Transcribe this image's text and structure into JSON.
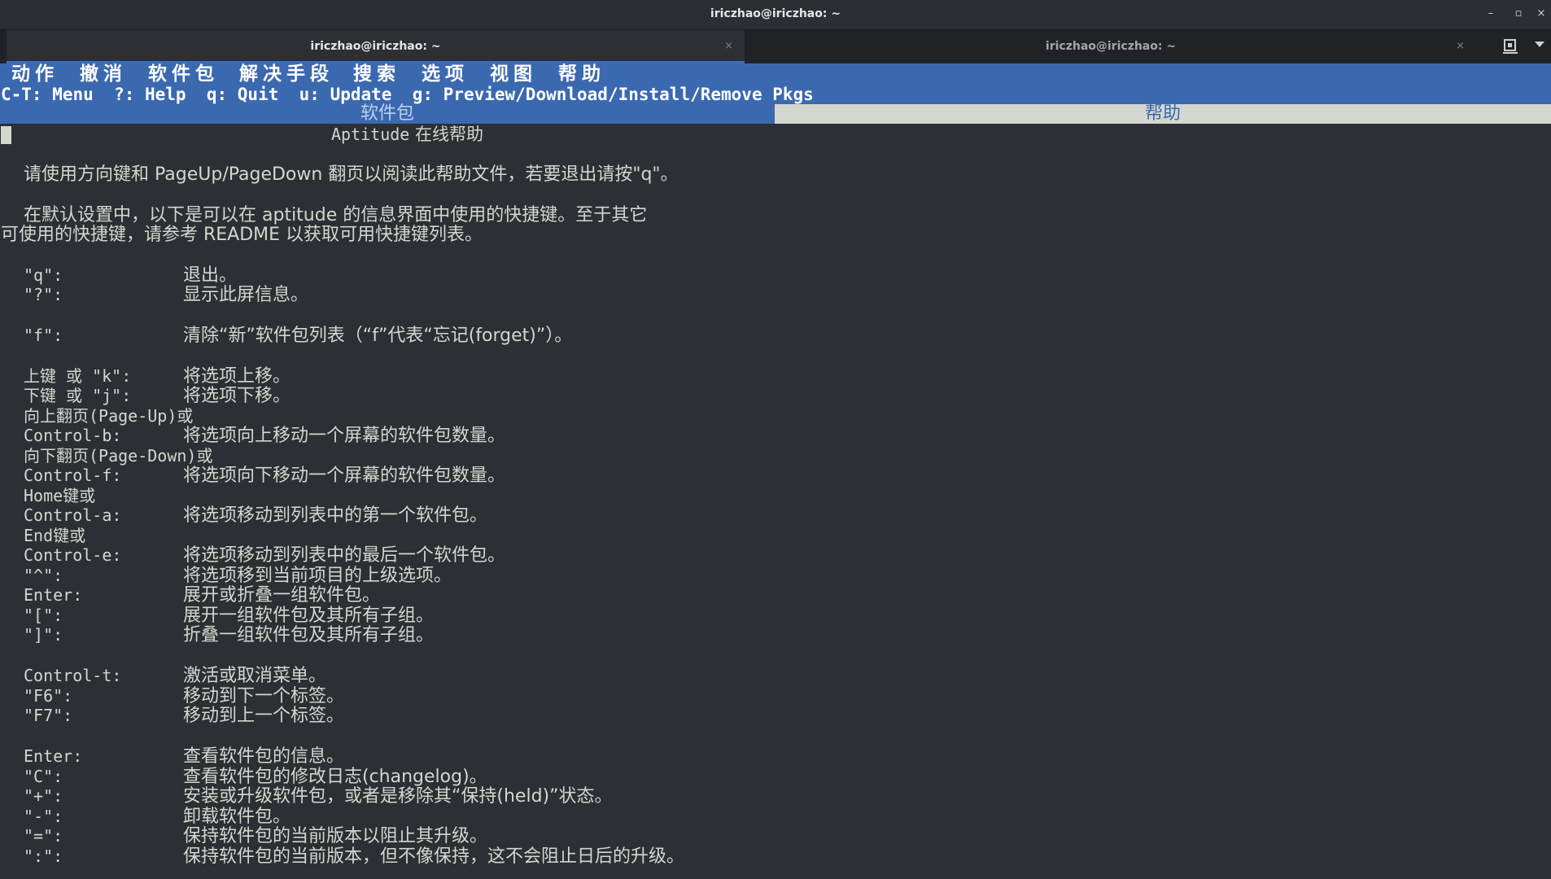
{
  "window": {
    "title": "iriczhao@iriczhao: ~",
    "controls": {
      "minimize": "–",
      "maximize": "▫",
      "close": "×"
    }
  },
  "tabs": [
    {
      "label": "iriczhao@iriczhao: ~",
      "active": true,
      "close": "×"
    },
    {
      "label": "iriczhao@iriczhao: ~",
      "active": false,
      "close": "×"
    }
  ],
  "menu": [
    "动作",
    "撤消",
    "软件包",
    "解决手段",
    "搜索",
    "选项",
    "视图",
    "帮助"
  ],
  "hint": "C-T: Menu  ?: Help  q: Quit  u: Update  g: Preview/Download/Install/Remove Pkgs",
  "view_tabs": {
    "packages": "软件包",
    "help": "帮助"
  },
  "doc": {
    "title_latin": "Aptitude",
    "title_cjk": " 在线帮助",
    "intro": "请使用方向键和 PageUp/PageDown 翻页以阅读此帮助文件，若要退出请按\"q\"。",
    "para1_line1": "在默认设置中，以下是可以在 aptitude 的信息界面中使用的快捷键。至于其它",
    "para1_line2": "可使用的快捷键，请参考 README 以获取可用快捷键列表。",
    "keys": [
      {
        "key": "\"q\":",
        "desc": "退出。"
      },
      {
        "key": "\"?\":",
        "desc": "显示此屏信息。"
      },
      {
        "key": "\"f\":",
        "desc": "清除“新”软件包列表（“f”代表“忘记(forget)”）。"
      },
      {
        "key": "上键 或 \"k\":",
        "desc": "将选项上移。"
      },
      {
        "key": "下键 或 \"j\":",
        "desc": "将选项下移。"
      },
      {
        "key": "向上翻页(Page-Up)或",
        "desc": ""
      },
      {
        "key": "Control-b:",
        "desc": "将选项向上移动一个屏幕的软件包数量。"
      },
      {
        "key": "向下翻页(Page-Down)或",
        "desc": ""
      },
      {
        "key": "Control-f:",
        "desc": "将选项向下移动一个屏幕的软件包数量。"
      },
      {
        "key": "Home键或",
        "desc": ""
      },
      {
        "key": "Control-a:",
        "desc": "将选项移动到列表中的第一个软件包。"
      },
      {
        "key": "End键或",
        "desc": ""
      },
      {
        "key": "Control-e:",
        "desc": "将选项移动到列表中的最后一个软件包。"
      },
      {
        "key": "\"^\":",
        "desc": "将选项移到当前项目的上级选项。"
      },
      {
        "key": "Enter:",
        "desc": "展开或折叠一组软件包。"
      },
      {
        "key": "\"[\":",
        "desc": "展开一组软件包及其所有子组。"
      },
      {
        "key": "\"]\":",
        "desc": "折叠一组软件包及其所有子组。"
      },
      {
        "key": "Control-t:",
        "desc": "激活或取消菜单。"
      },
      {
        "key": "\"F6\":",
        "desc": "移动到下一个标签。"
      },
      {
        "key": "\"F7\":",
        "desc": "移动到上一个标签。"
      },
      {
        "key": "Enter:",
        "desc": "查看软件包的信息。"
      },
      {
        "key": "\"C\":",
        "desc": "查看软件包的修改日志(changelog)。"
      },
      {
        "key": "\"+\":",
        "desc": "安装或升级软件包，或者是移除其“保持(held)”状态。"
      },
      {
        "key": "\"-\":",
        "desc": "卸载软件包。"
      },
      {
        "key": "\"=\":",
        "desc": "保持软件包的当前版本以阻止其升级。"
      },
      {
        "key": "\":\":",
        "desc": "保持软件包的当前版本，但不像保持，这不会阻止日后的升级。"
      }
    ]
  },
  "colors": {
    "accent": "#3b69b0",
    "terminal_bg": "#2c2f33",
    "text": "#d3d7cf"
  }
}
